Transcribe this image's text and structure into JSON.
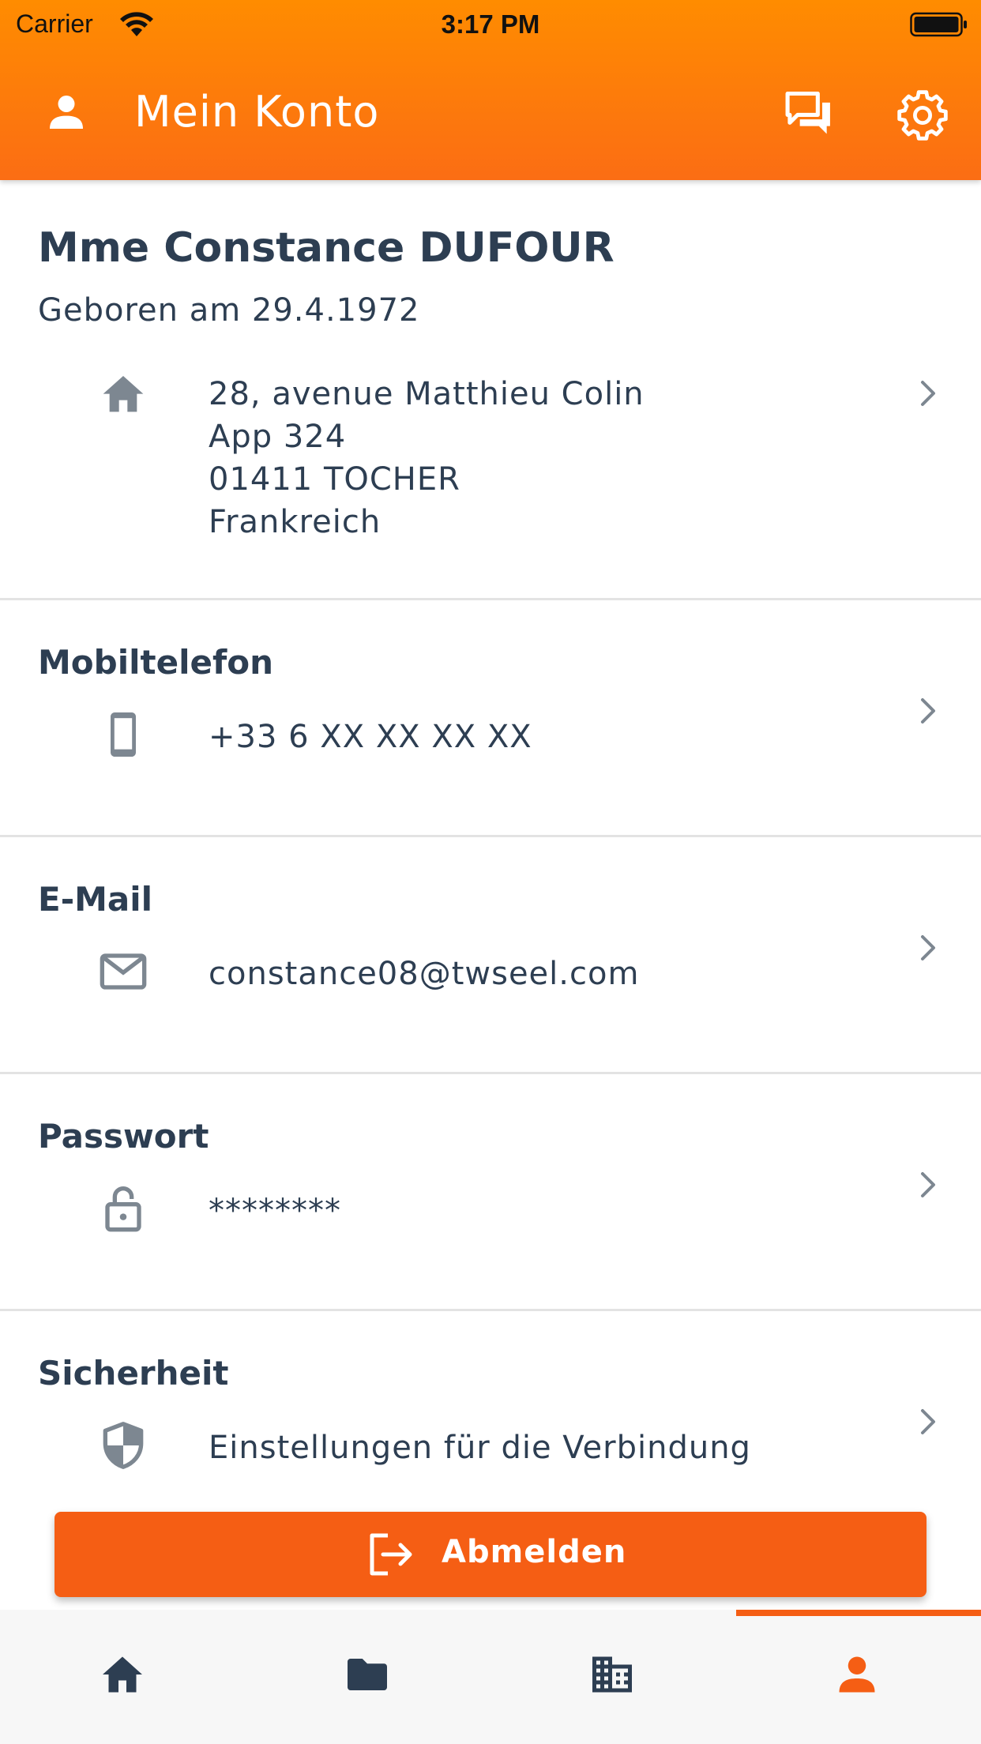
{
  "status_bar": {
    "carrier": "Carrier",
    "time": "3:17 PM"
  },
  "header": {
    "title": "Mein Konto",
    "icons": [
      "user-icon",
      "chat-icon",
      "gear-icon"
    ]
  },
  "profile": {
    "name": "Mme Constance DUFOUR",
    "birth": "Geboren am 29.4.1972",
    "address": [
      "28, avenue Matthieu Colin",
      "App 324",
      "01411 TOCHER",
      "Frankreich"
    ]
  },
  "sections": {
    "mobile": {
      "title": "Mobiltelefon",
      "value": "+33 6 XX XX XX XX",
      "icon": "phone-icon"
    },
    "email": {
      "title": "E-Mail",
      "value": "constance08@twseel.com",
      "icon": "mail-icon"
    },
    "password": {
      "title": "Passwort",
      "value": "********",
      "icon": "lock-icon"
    },
    "security": {
      "title": "Sicherheit",
      "value": "Einstellungen für die Verbindung",
      "icon": "shield-icon"
    }
  },
  "logout": {
    "label": "Abmelden"
  },
  "tabbar": {
    "items": [
      "home-icon",
      "folder-icon",
      "building-icon",
      "account-icon"
    ],
    "active": "account-icon"
  },
  "colors": {
    "accent": "#f55e14",
    "header_top": "#ff8c00",
    "text": "#2d3e52",
    "icon_gray": "#7d8791",
    "tab_icon": "#2d3e52",
    "divider": "#e3e3e3"
  }
}
